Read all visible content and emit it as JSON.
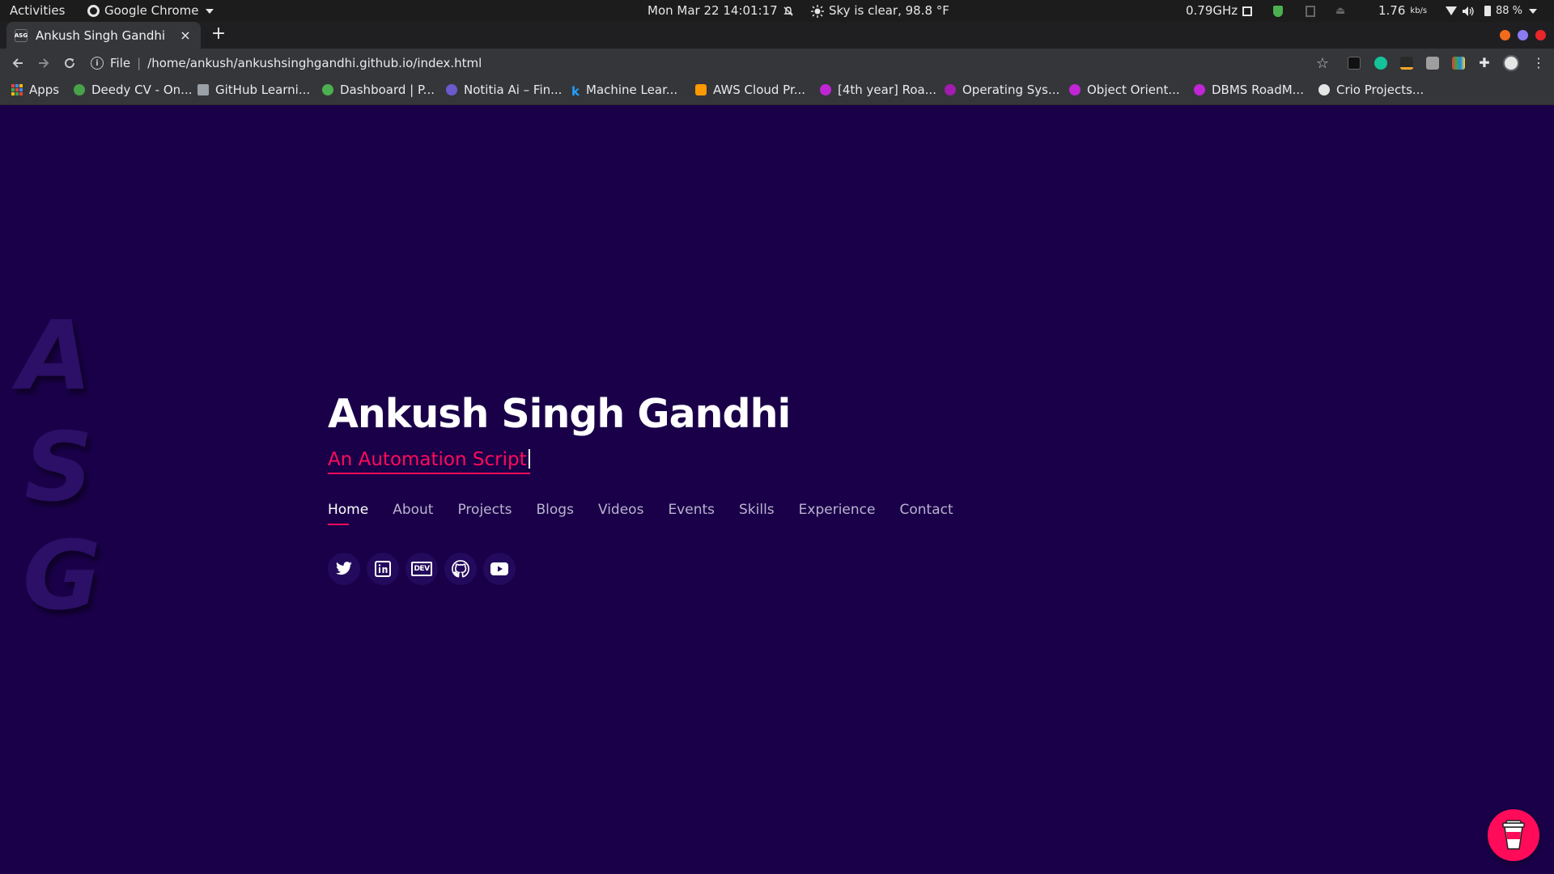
{
  "topbar": {
    "activities": "Activities",
    "app_name": "Google Chrome",
    "datetime": "Mon Mar 22  14:01:17",
    "weather": "Sky is clear, 98.8 °F",
    "cpu_freq": "0.79GHz",
    "net_speed": "1.76",
    "net_unit": "kb/s",
    "battery": "88 %"
  },
  "tab": {
    "favicon_text": "ASG",
    "title": "Ankush Singh Gandhi",
    "close": "×",
    "new_tab": "+"
  },
  "toolbar": {
    "scheme": "File",
    "url": "/home/ankush/ankushsinghgandhi.github.io/index.html"
  },
  "bookmarks": [
    {
      "label": "Apps",
      "color": "#e94235"
    },
    {
      "label": "Deedy CV - On...",
      "color": "#47a248"
    },
    {
      "label": "GitHub Learni...",
      "color": "#9aa0a6"
    },
    {
      "label": "Dashboard | P...",
      "color": "#4caf50"
    },
    {
      "label": "Notitia Ai – Fin...",
      "color": "#6a5acd"
    },
    {
      "label": "Machine Lear...",
      "color": "#20a0ff"
    },
    {
      "label": "AWS Cloud Pr...",
      "color": "#ff9900"
    },
    {
      "label": "[4th year] Roa...",
      "color": "#c026d3"
    },
    {
      "label": "Operating Sys...",
      "color": "#a21caf"
    },
    {
      "label": "Object Orient...",
      "color": "#c026d3"
    },
    {
      "label": "DBMS RoadM...",
      "color": "#c026d3"
    },
    {
      "label": "Crio Projects...",
      "color": "#e5e5e5"
    }
  ],
  "page": {
    "bg_letters": [
      "A",
      "S",
      "G"
    ],
    "name": "Ankush Singh Gandhi",
    "subtitle": "An Automation Script",
    "nav": [
      {
        "label": "Home",
        "active": true
      },
      {
        "label": "About"
      },
      {
        "label": "Projects"
      },
      {
        "label": "Blogs"
      },
      {
        "label": "Videos"
      },
      {
        "label": "Events"
      },
      {
        "label": "Skills"
      },
      {
        "label": "Experience"
      },
      {
        "label": "Contact"
      }
    ],
    "socials": [
      "twitter-icon",
      "linkedin-icon",
      "dev-icon",
      "github-icon",
      "youtube-icon"
    ],
    "dev_badge": "DEV"
  },
  "colors": {
    "page_bg": "#1a0049",
    "accent": "#ff0b5a",
    "text": "#ffffff",
    "nav_text": "#b9b3cf"
  }
}
